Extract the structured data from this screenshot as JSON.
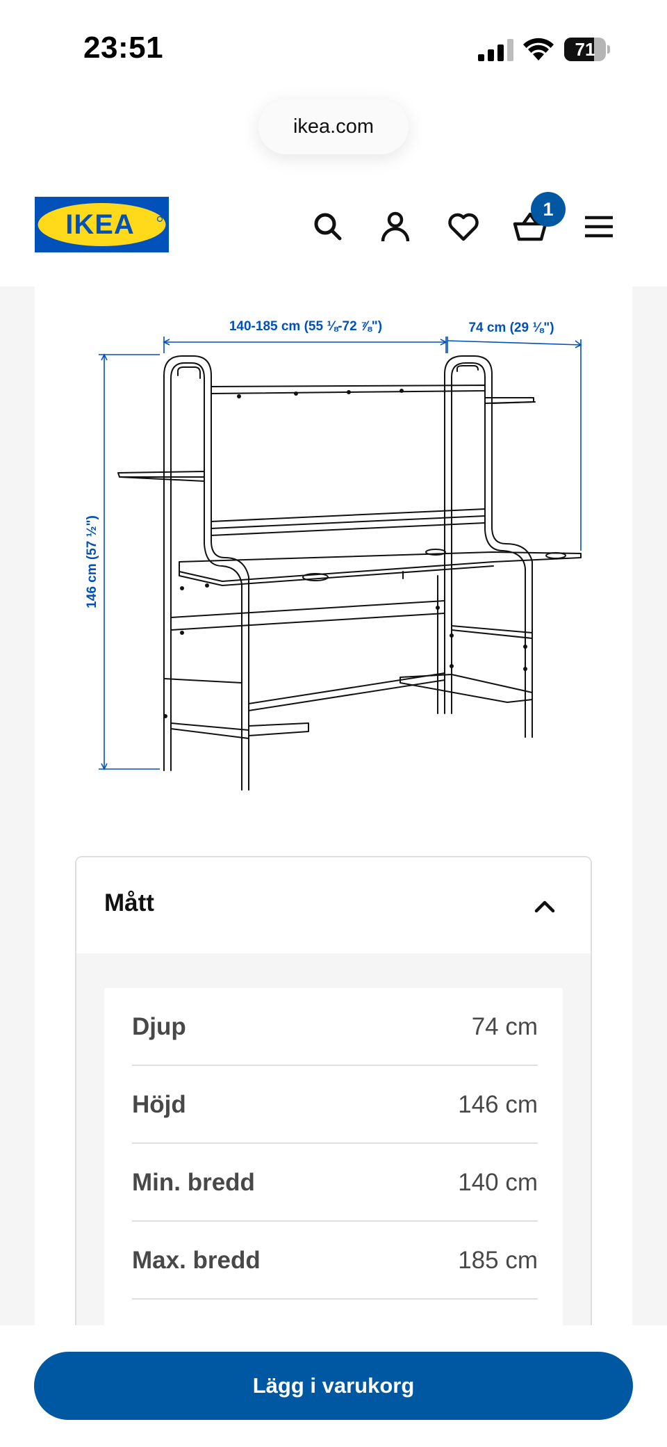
{
  "status_bar": {
    "time": "23:51",
    "battery": "71"
  },
  "browser": {
    "url": "ikea.com"
  },
  "header": {
    "logo_text": "IKEA",
    "cart_count": "1",
    "brand_colors": {
      "blue": "#0058a3",
      "yellow": "#ffda1a",
      "logo_blue": "#0051ba"
    },
    "icons": [
      "search-icon",
      "profile-icon",
      "heart-icon",
      "cart-icon",
      "menu-icon"
    ]
  },
  "drawing": {
    "width_label": "140-185 cm (55 ⅛-72 ⅞\")",
    "depth_label": "74 cm (29 ⅛\")",
    "height_label": "146 cm (57 ½\")",
    "dimension_color": "#0051ba"
  },
  "accordion": {
    "title": "Mått",
    "expanded": true,
    "rows": [
      {
        "label": "Djup",
        "value": "74 cm"
      },
      {
        "label": "Höjd",
        "value": "146 cm"
      },
      {
        "label": "Min. bredd",
        "value": "140 cm"
      },
      {
        "label": "Max. bredd",
        "value": "185 cm"
      }
    ]
  },
  "cta": {
    "label": "Lägg i varukorg"
  }
}
